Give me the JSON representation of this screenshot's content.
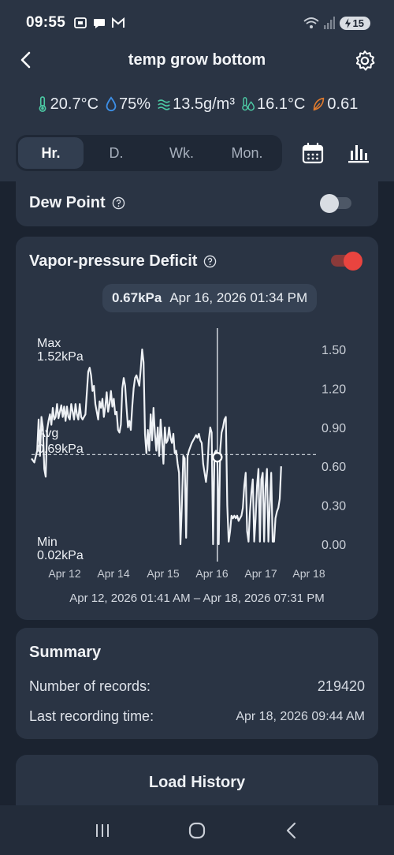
{
  "status_bar": {
    "time": "09:55",
    "battery": "15"
  },
  "header": {
    "title": "temp grow bottom"
  },
  "metrics": [
    {
      "icon": "thermometer-icon",
      "value": "20.7°C",
      "color": "#4cc9a4"
    },
    {
      "icon": "humidity-drop-icon",
      "value": "75%",
      "color": "#3d8fe6"
    },
    {
      "icon": "absolute-humidity-icon",
      "value": "13.5g/m³",
      "color": "#4cc9a4"
    },
    {
      "icon": "dew-point-icon",
      "value": "16.1°C",
      "color": "#4cc9a4"
    },
    {
      "icon": "vpd-leaf-icon",
      "value": "0.61",
      "color": "#e07a2e"
    }
  ],
  "periods": {
    "hour": "Hr.",
    "day": "D.",
    "week": "Wk.",
    "month": "Mon.",
    "active": "Hr."
  },
  "dew_point": {
    "title": "Dew Point",
    "enabled": false
  },
  "vpd": {
    "title": "Vapor-pressure Deficit",
    "enabled": true,
    "tooltip_value": "0.67kPa",
    "tooltip_time": "Apr 16, 2026 01:34 PM",
    "range_text": "Apr 12, 2026 01:41 AM – Apr 18, 2026 07:31 PM"
  },
  "chart_data": {
    "type": "line",
    "unit": "kPa",
    "y_ticks": [
      "1.50",
      "1.20",
      "0.90",
      "0.60",
      "0.30",
      "0.00"
    ],
    "x_ticks": [
      "Apr 12",
      "Apr 14",
      "Apr 15",
      "Apr 16",
      "Apr 17",
      "Apr 18"
    ],
    "ylim": [
      0,
      1.5
    ],
    "max_label": "Max",
    "max_value": "1.52kPa",
    "avg_label": "Avg",
    "avg_value": "0.69kPa",
    "avg": 0.69,
    "min_label": "Min",
    "min_value": "0.02kPa",
    "selected_x": 0.655,
    "selected_y": 0.67,
    "series": [
      {
        "points": [
          [
            0.0,
            0.66
          ],
          [
            0.01,
            0.63
          ],
          [
            0.02,
            0.72
          ],
          [
            0.025,
            0.96
          ],
          [
            0.03,
            0.68
          ],
          [
            0.035,
            0.98
          ],
          [
            0.04,
            0.9
          ],
          [
            0.045,
            0.58
          ],
          [
            0.05,
            0.52
          ],
          [
            0.055,
            0.88
          ],
          [
            0.06,
            0.95
          ],
          [
            0.065,
            1.0
          ],
          [
            0.07,
            0.92
          ],
          [
            0.075,
            1.05
          ],
          [
            0.08,
            0.96
          ],
          [
            0.085,
            0.98
          ],
          [
            0.09,
            1.08
          ],
          [
            0.095,
            0.97
          ],
          [
            0.1,
            1.02
          ],
          [
            0.105,
            1.07
          ],
          [
            0.11,
            0.98
          ],
          [
            0.115,
            1.06
          ],
          [
            0.12,
            0.95
          ],
          [
            0.125,
            1.06
          ],
          [
            0.13,
            0.98
          ],
          [
            0.135,
            0.96
          ],
          [
            0.14,
            1.08
          ],
          [
            0.145,
            1.02
          ],
          [
            0.15,
            0.96
          ],
          [
            0.155,
            1.08
          ],
          [
            0.16,
            1.0
          ],
          [
            0.165,
            0.96
          ],
          [
            0.17,
            1.08
          ],
          [
            0.175,
            0.98
          ],
          [
            0.18,
            0.96
          ],
          [
            0.19,
            1.0
          ],
          [
            0.2,
            1.33
          ],
          [
            0.205,
            1.36
          ],
          [
            0.21,
            1.3
          ],
          [
            0.215,
            1.18
          ],
          [
            0.22,
            1.22
          ],
          [
            0.225,
            1.08
          ],
          [
            0.23,
            1.02
          ],
          [
            0.235,
            0.96
          ],
          [
            0.24,
            1.1
          ],
          [
            0.245,
            1.05
          ],
          [
            0.25,
            1.12
          ],
          [
            0.255,
            0.98
          ],
          [
            0.26,
            1.06
          ],
          [
            0.265,
            1.17
          ],
          [
            0.27,
            1.02
          ],
          [
            0.275,
            1.08
          ],
          [
            0.28,
            1.18
          ],
          [
            0.285,
            1.06
          ],
          [
            0.29,
            1.12
          ],
          [
            0.295,
            1.0
          ],
          [
            0.3,
            1.02
          ],
          [
            0.305,
            0.88
          ],
          [
            0.31,
            0.86
          ],
          [
            0.315,
            0.92
          ],
          [
            0.32,
            1.2
          ],
          [
            0.325,
            1.28
          ],
          [
            0.33,
            1.22
          ],
          [
            0.335,
            1.05
          ],
          [
            0.34,
            0.9
          ],
          [
            0.345,
            0.95
          ],
          [
            0.35,
            0.88
          ],
          [
            0.355,
            1.06
          ],
          [
            0.36,
            1.2
          ],
          [
            0.365,
            1.28
          ],
          [
            0.37,
            1.3
          ],
          [
            0.375,
            1.26
          ],
          [
            0.38,
            1.22
          ],
          [
            0.385,
            1.35
          ],
          [
            0.39,
            1.5
          ],
          [
            0.395,
            1.4
          ],
          [
            0.4,
            0.85
          ],
          [
            0.405,
            0.7
          ],
          [
            0.41,
            0.88
          ],
          [
            0.415,
            0.72
          ],
          [
            0.42,
            1.0
          ],
          [
            0.425,
            0.8
          ],
          [
            0.43,
            1.05
          ],
          [
            0.435,
            0.85
          ],
          [
            0.44,
            0.72
          ],
          [
            0.445,
            0.9
          ],
          [
            0.45,
            0.68
          ],
          [
            0.455,
            0.96
          ],
          [
            0.46,
            0.8
          ],
          [
            0.465,
            0.62
          ],
          [
            0.47,
            0.9
          ],
          [
            0.475,
            0.78
          ],
          [
            0.48,
            0.8
          ],
          [
            0.485,
            0.9
          ],
          [
            0.49,
            0.82
          ],
          [
            0.495,
            0.78
          ],
          [
            0.5,
            0.85
          ],
          [
            0.505,
            0.7
          ],
          [
            0.51,
            0.72
          ],
          [
            0.515,
            0.62
          ],
          [
            0.52,
            0.55
          ],
          [
            0.525,
            0.0
          ],
          [
            0.53,
            0.3
          ],
          [
            0.535,
            0.68
          ],
          [
            0.54,
            0.66
          ],
          [
            0.545,
            0.05
          ],
          [
            0.55,
            0.68
          ],
          [
            0.555,
            0.72
          ],
          [
            0.56,
            0.75
          ],
          [
            0.565,
            0.78
          ],
          [
            0.57,
            0.8
          ],
          [
            0.575,
            0.82
          ],
          [
            0.58,
            0.84
          ],
          [
            0.585,
            0.82
          ],
          [
            0.59,
            0.85
          ],
          [
            0.595,
            0.8
          ],
          [
            0.6,
            0.78
          ],
          [
            0.605,
            0.62
          ],
          [
            0.61,
            0.55
          ],
          [
            0.615,
            0.48
          ],
          [
            0.62,
            0.58
          ],
          [
            0.625,
            0.8
          ],
          [
            0.63,
            0.9
          ],
          [
            0.635,
            0.86
          ],
          [
            0.64,
            0.0
          ],
          [
            0.645,
            0.7
          ],
          [
            0.65,
            0.72
          ],
          [
            0.655,
            0.67
          ],
          [
            0.66,
            0.0
          ],
          [
            0.665,
            0.72
          ],
          [
            0.67,
            0.86
          ],
          [
            0.675,
            0.9
          ],
          [
            0.68,
            0.96
          ],
          [
            0.685,
            0.98
          ],
          [
            0.69,
            0.3
          ],
          [
            0.695,
            0.02
          ],
          [
            0.7,
            0.1
          ],
          [
            0.705,
            0.22
          ],
          [
            0.71,
            0.2
          ],
          [
            0.715,
            0.22
          ],
          [
            0.72,
            0.2
          ],
          [
            0.725,
            0.22
          ],
          [
            0.73,
            0.18
          ],
          [
            0.735,
            0.2
          ],
          [
            0.74,
            0.22
          ],
          [
            0.745,
            0.28
          ],
          [
            0.75,
            0.45
          ],
          [
            0.755,
            0.55
          ],
          [
            0.76,
            0.1
          ],
          [
            0.765,
            0.02
          ],
          [
            0.77,
            0.25
          ],
          [
            0.775,
            0.4
          ],
          [
            0.78,
            0.5
          ],
          [
            0.785,
            0.02
          ],
          [
            0.79,
            0.2
          ],
          [
            0.795,
            0.45
          ],
          [
            0.8,
            0.58
          ],
          [
            0.805,
            0.02
          ],
          [
            0.81,
            0.5
          ],
          [
            0.815,
            0.55
          ],
          [
            0.82,
            0.02
          ],
          [
            0.825,
            0.45
          ],
          [
            0.83,
            0.58
          ],
          [
            0.835,
            0.02
          ],
          [
            0.84,
            0.3
          ],
          [
            0.845,
            0.55
          ],
          [
            0.85,
            0.02
          ],
          [
            0.855,
            0.02
          ],
          [
            0.86,
            0.2
          ],
          [
            0.865,
            0.25
          ],
          [
            0.87,
            0.28
          ],
          [
            0.875,
            0.35
          ],
          [
            0.88,
            0.6
          ]
        ]
      }
    ]
  },
  "summary": {
    "title": "Summary",
    "records_label": "Number of records:",
    "records_value": "219420",
    "last_label": "Last recording time:",
    "last_value": "Apr 18, 2026 09:44 AM"
  },
  "load_history": {
    "label": "Load History"
  },
  "colors": {
    "accent_red": "#e9443f",
    "line": "#eef1f5",
    "toggle_off": "#8c96a3"
  }
}
